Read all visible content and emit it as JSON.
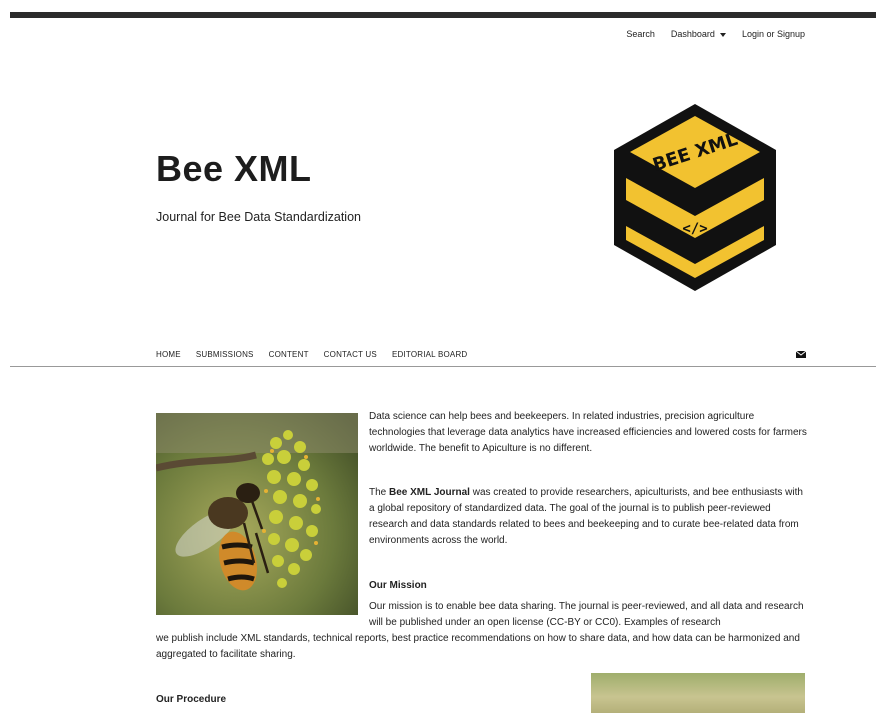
{
  "utility_nav": {
    "search": "Search",
    "dashboard": "Dashboard",
    "login": "Login or Signup"
  },
  "site": {
    "title": "Bee XML",
    "tagline": "Journal for Bee Data Standardization",
    "logo_text": "BEE XML",
    "logo_code": "</>"
  },
  "nav": [
    "HOME",
    "SUBMISSIONS",
    "CONTENT",
    "CONTACT US",
    "EDITORIAL BOARD"
  ],
  "icons": {
    "mail": "envelope-icon"
  },
  "content": {
    "p1": "Data science can help bees and beekeepers.  In related industries, precision agriculture technologies that leverage data analytics have increased efficiencies and lowered costs for farmers worldwide.  The benefit to Apiculture is no different.",
    "p2_prefix": "The ",
    "p2_bold": "Bee XML Journal",
    "p2_rest": " was created to provide researchers,  apiculturists, and bee enthusiasts with a global repository of standardized data.  The goal of the journal is to publish peer-reviewed research and data standards related to bees and beekeeping and to curate bee-related data from environments across the world.",
    "mission_heading": "Our Mission",
    "mission_a": "Our mission is to enable bee data sharing.  The journal is peer-reviewed, and all data and research will be published under an open license (CC-BY or CC0).  Examples of research",
    "mission_b": "we publish include XML standards, technical reports, best practice recommendations on how to share data, and how data can be harmonized and aggregated to facilitate sharing.",
    "procedure_heading": "Our Procedure"
  },
  "colors": {
    "accent": "#f2c230",
    "dark": "#111111",
    "topbar": "#2b2b2b"
  }
}
